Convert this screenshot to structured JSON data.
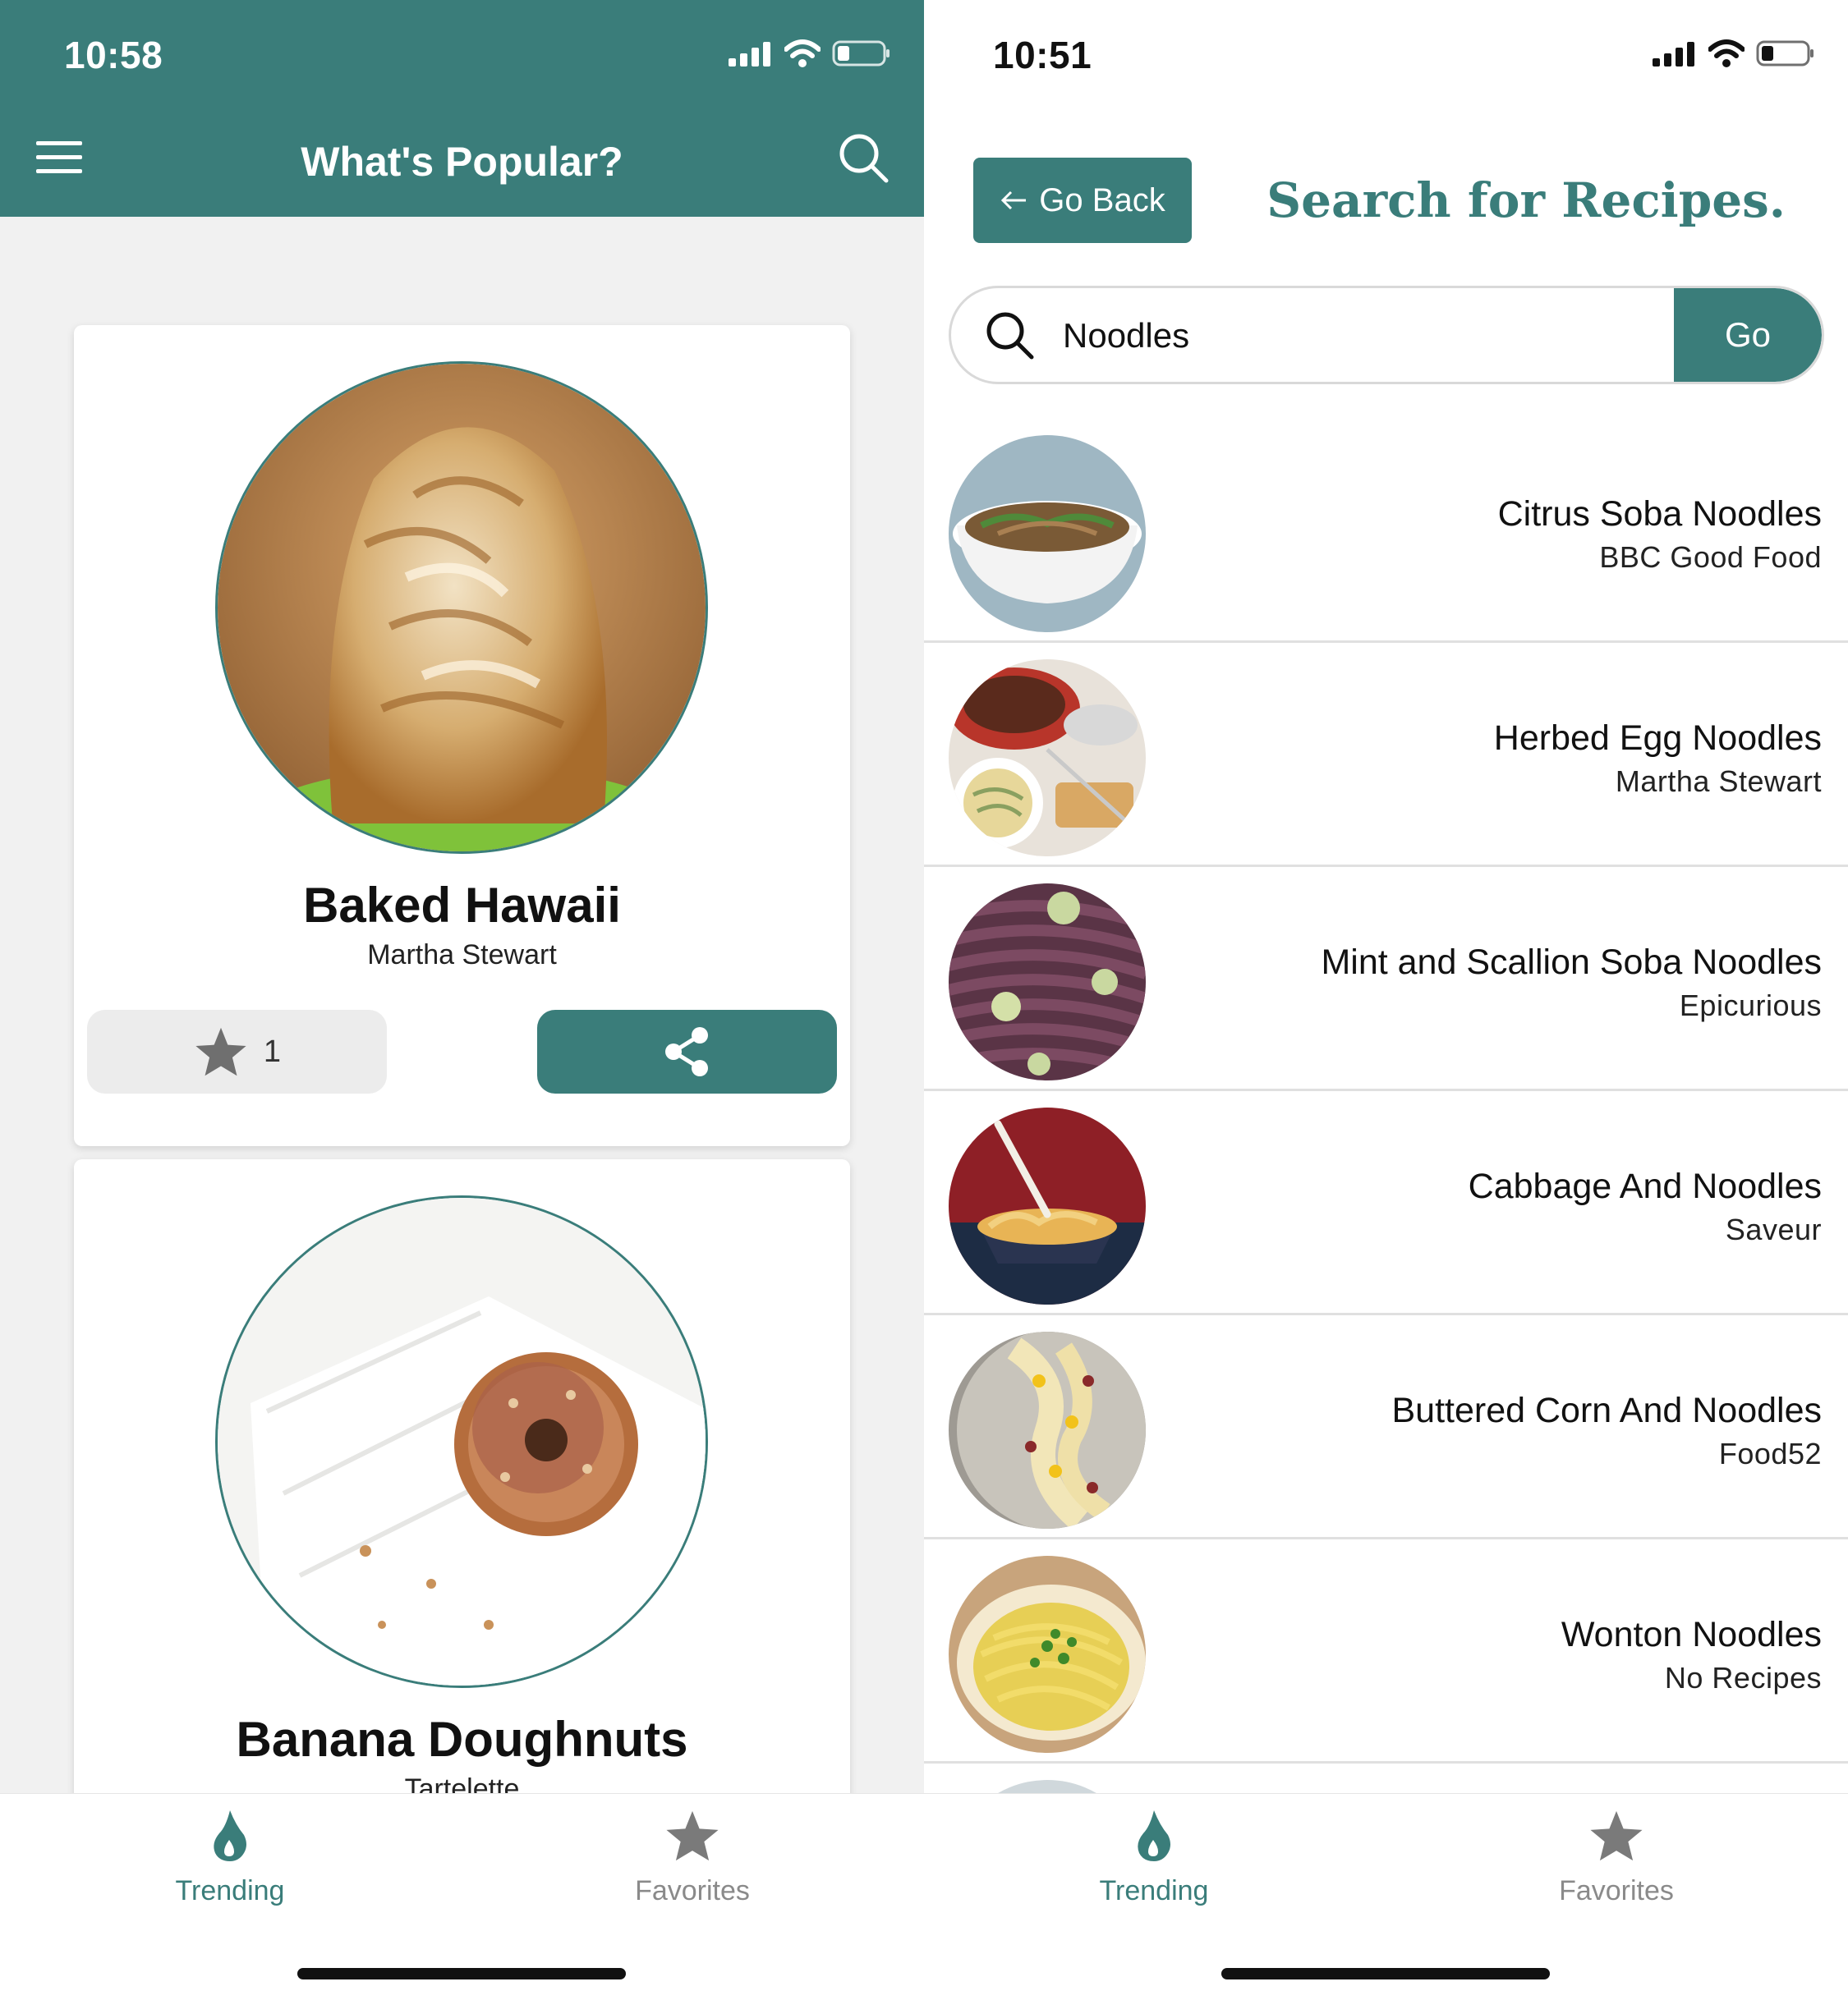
{
  "left_screen": {
    "status": {
      "time": "10:58"
    },
    "header": {
      "title": "What's Popular?"
    },
    "cards": [
      {
        "name": "Baked Hawaii",
        "source": "Martha Stewart",
        "favorite_count": "1"
      },
      {
        "name": "Banana Doughnuts",
        "source": "Tartelette"
      }
    ],
    "tabs": [
      {
        "label": "Trending",
        "icon": "flame-icon",
        "active": true
      },
      {
        "label": "Favorites",
        "icon": "star-icon",
        "active": false
      }
    ]
  },
  "right_screen": {
    "status": {
      "time": "10:51"
    },
    "go_back_label": "Go Back",
    "title": "Search for Recipes.",
    "search": {
      "value": "Noodles",
      "go_label": "Go"
    },
    "results": [
      {
        "name": "Citrus Soba Noodles",
        "source": "BBC Good Food"
      },
      {
        "name": "Herbed Egg Noodles",
        "source": "Martha Stewart"
      },
      {
        "name": "Mint and Scallion Soba Noodles",
        "source": "Epicurious"
      },
      {
        "name": "Cabbage And Noodles",
        "source": "Saveur"
      },
      {
        "name": "Buttered Corn And Noodles",
        "source": "Food52"
      },
      {
        "name": "Wonton Noodles",
        "source": "No Recipes"
      }
    ],
    "tabs": [
      {
        "label": "Trending",
        "icon": "flame-icon",
        "active": true
      },
      {
        "label": "Favorites",
        "icon": "star-icon",
        "active": false
      }
    ]
  },
  "colors": {
    "accent": "#3a7d7a",
    "feed_background": "#f1f1f1",
    "inactive": "#8a8a8a"
  }
}
